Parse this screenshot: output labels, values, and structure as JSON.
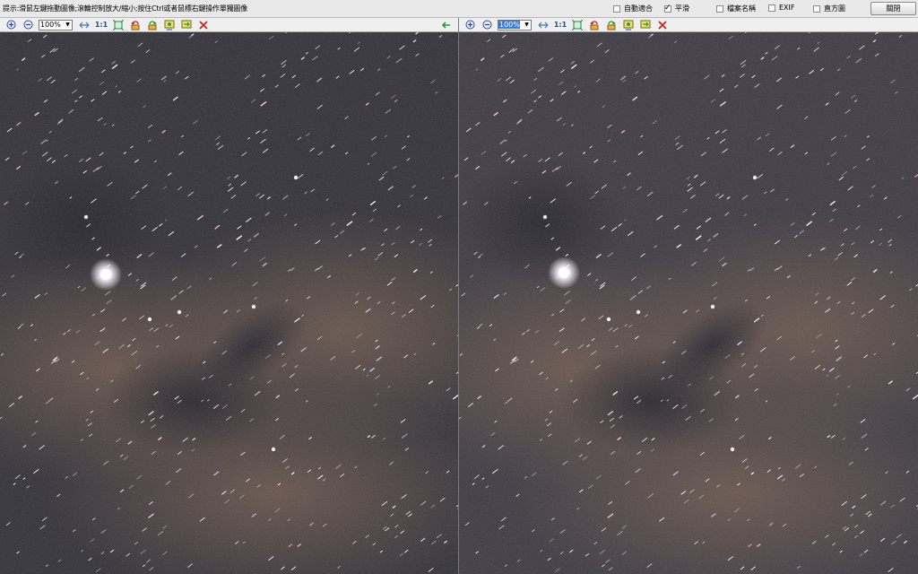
{
  "window": {
    "hint": "提示:滑鼠左鍵拖動圖像;滾輪控制放大/縮小;按住Ctrl或者鼠標右鍵操作單獨圖像",
    "close_label": "關閉"
  },
  "options": [
    {
      "label": "自動適合",
      "checked": false
    },
    {
      "label": "平滑",
      "checked": true
    },
    {
      "label": "檔案名稱",
      "checked": false
    },
    {
      "label": "EXIF",
      "checked": false
    },
    {
      "label": "直方圖",
      "checked": false
    }
  ],
  "left_toolbar": {
    "zoom_value": "100%",
    "one_to_one": "1:1"
  },
  "right_toolbar": {
    "zoom_value": "100%",
    "one_to_one": "1:1"
  },
  "icons": [
    "zoom-in-icon",
    "zoom-out-icon",
    "fit-width-icon",
    "actual-size-icon",
    "fit-window-icon",
    "rotate-left-icon",
    "rotate-right-icon",
    "flip-icon",
    "swap-icon",
    "close-image-icon",
    "sync-icon"
  ],
  "colors": {
    "starfield_dark": "#2b2930",
    "nebula_brown": "#5a4a44",
    "delete_red": "#d42020",
    "sync_green": "#2aa02a"
  }
}
